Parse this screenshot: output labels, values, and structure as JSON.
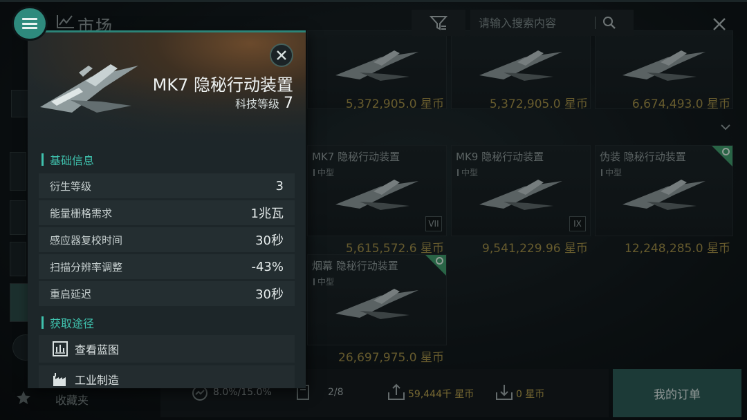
{
  "header": {
    "title": "市场",
    "search_placeholder": "请输入搜索内容"
  },
  "sidebar": {
    "favorites_label": "收藏夹"
  },
  "grid": {
    "top_prices": [
      "5,372,905.0 星币",
      "5,372,905.0 星币",
      "6,674,493.0 星币"
    ],
    "cards": [
      {
        "name": "MK7 隐秘行动装置",
        "size": "中型",
        "tier": "VII",
        "price": "5,615,572.6 星币",
        "corner": false
      },
      {
        "name": "MK9 隐秘行动装置",
        "size": "中型",
        "tier": "IX",
        "price": "9,541,229.96 星币",
        "corner": false
      },
      {
        "name": "伪装 隐秘行动装置",
        "size": "中型",
        "tier": "",
        "price": "12,248,285.0 星币",
        "corner": true
      },
      {
        "name": "烟幕 隐秘行动装置",
        "size": "中型",
        "tier": "",
        "price": "26,697,975.0 星币",
        "corner": true
      }
    ]
  },
  "bottom": {
    "percent": "8.0%/15.0%",
    "slots": "2/8",
    "sell_total": "59,444千 星币",
    "buy_total": "0 星币",
    "my_orders": "我的订单"
  },
  "panel": {
    "item_name": "MK7 隐秘行动装置",
    "tech_label": "科技等级",
    "tech_level": "7",
    "basic_info_title": "基础信息",
    "attributes": [
      {
        "key": "衍生等级",
        "value": "3"
      },
      {
        "key": "能量栅格需求",
        "value": "1兆瓦"
      },
      {
        "key": "感应器复校时间",
        "value": "30秒"
      },
      {
        "key": "扫描分辨率调整",
        "value": "-43%"
      },
      {
        "key": "重启延迟",
        "value": "30秒"
      }
    ],
    "acquire_title": "获取途径",
    "sources": [
      {
        "label": "查看蓝图",
        "icon": "blueprint-icon"
      },
      {
        "label": "工业制造",
        "icon": "factory-icon"
      }
    ]
  },
  "colors": {
    "accent": "#3fc1ad",
    "price": "#b6a04d",
    "menu_button": "#2e8a7d"
  }
}
